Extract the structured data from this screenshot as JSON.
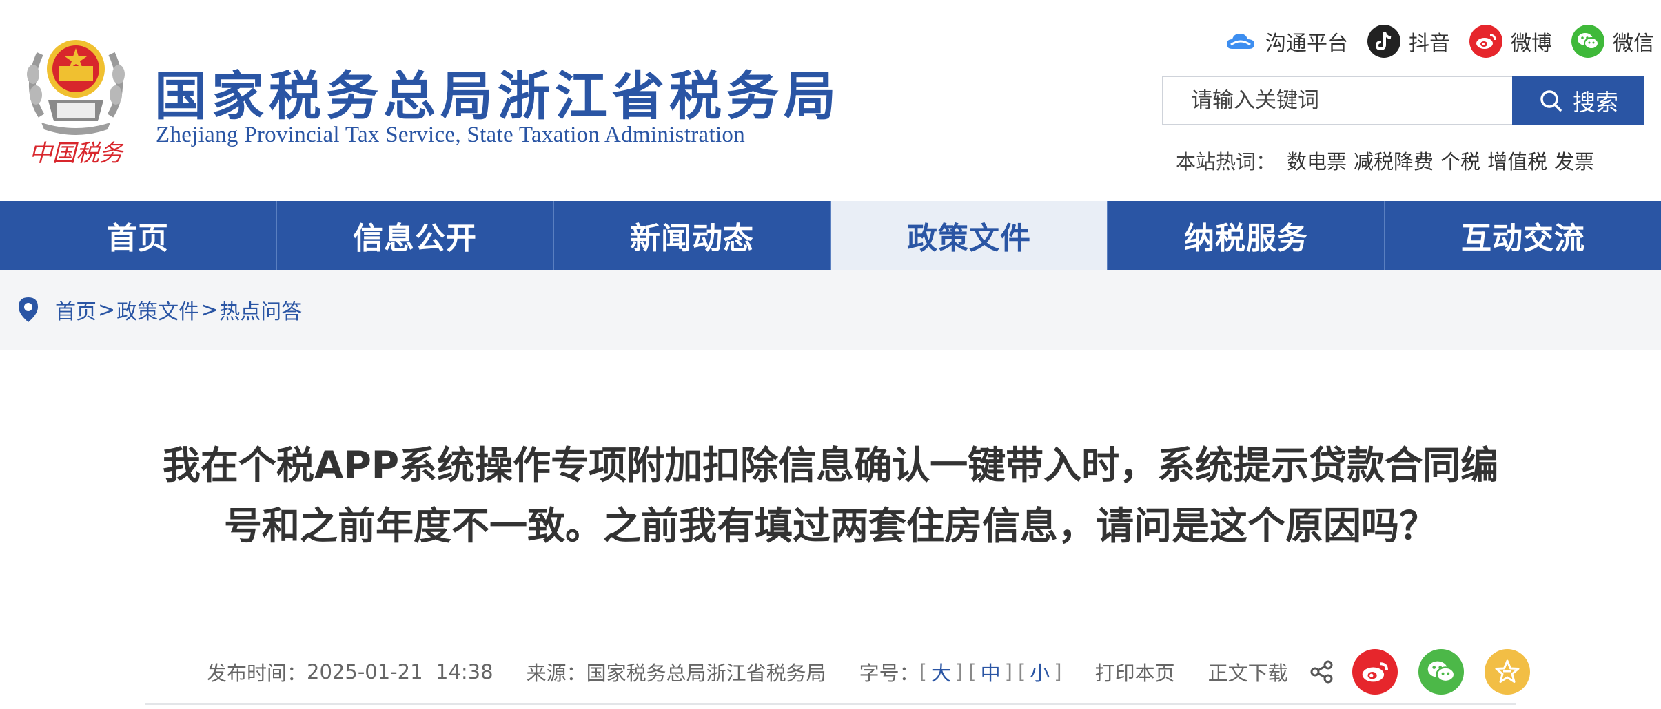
{
  "header": {
    "emblem_text": "中国税务",
    "title": "国家税务总局浙江省税务局",
    "subtitle": "Zhejiang Provincial Tax Service, State Taxation Administration",
    "social": [
      {
        "label": "沟通平台",
        "icon": "cloud-icon",
        "color": "#3d8ef0"
      },
      {
        "label": "抖音",
        "icon": "douyin-icon",
        "color": "#222222"
      },
      {
        "label": "微博",
        "icon": "weibo-icon",
        "color": "#e6262c"
      },
      {
        "label": "微信",
        "icon": "wechat-icon",
        "color": "#3fb93a"
      }
    ],
    "search": {
      "placeholder": "请输入关键词",
      "button": "搜索"
    },
    "hot_label": "本站热词：",
    "hot_words": [
      "数电票",
      "减税降费",
      "个税",
      "增值税",
      "发票"
    ]
  },
  "nav": {
    "items": [
      "首页",
      "信息公开",
      "新闻动态",
      "政策文件",
      "纳税服务",
      "互动交流"
    ],
    "active_index": 3
  },
  "breadcrumb": {
    "items": [
      "首页",
      "政策文件",
      "热点问答"
    ],
    "separator": ">"
  },
  "article": {
    "title": "我在个税APP系统操作专项附加扣除信息确认一键带入时，系统提示贷款合同编号和之前年度不一致。之前我有填过两套住房信息，请问是这个原因吗？",
    "publish_label": "发布时间：",
    "publish_time": "2025-01-21  14:38",
    "source_label": "来源：",
    "source": "国家税务总局浙江省税务局",
    "font_label": "字号：",
    "font_sizes": [
      "大",
      "中",
      "小"
    ],
    "print": "打印本页",
    "download": "正文下载"
  },
  "colors": {
    "brand": "#2a55a4",
    "active_nav_bg": "#e9eef6",
    "weibo": "#e6262c",
    "wechat": "#4cb848",
    "favorite": "#f2be45"
  }
}
